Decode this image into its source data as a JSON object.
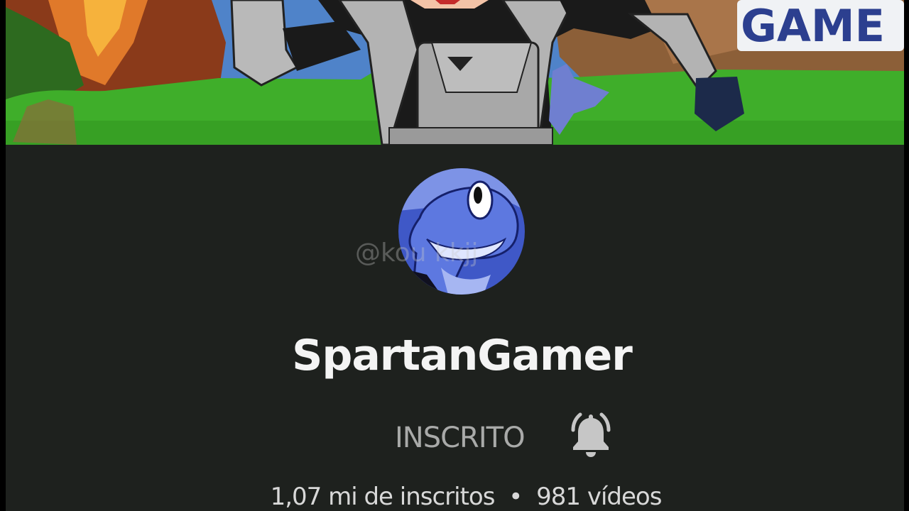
{
  "channel": {
    "name": "SpartanGamer",
    "watermark": "@kou  kkjj",
    "subscribe_status": "INSCRITO",
    "subscribers": "1,07 mi de inscritos",
    "separator": "•",
    "videos": "981 vídeos"
  },
  "banner": {
    "logo_text": "GAME"
  },
  "icons": {
    "bell": "bell-icon",
    "avatar": "dinosaur-avatar"
  },
  "colors": {
    "background": "#1e211e",
    "text_primary": "#f4f4f4",
    "text_muted": "#a9aaa9",
    "grass": "#3fae2a",
    "sky": "#4f83c9",
    "logo_blue": "#2c3f8f"
  }
}
